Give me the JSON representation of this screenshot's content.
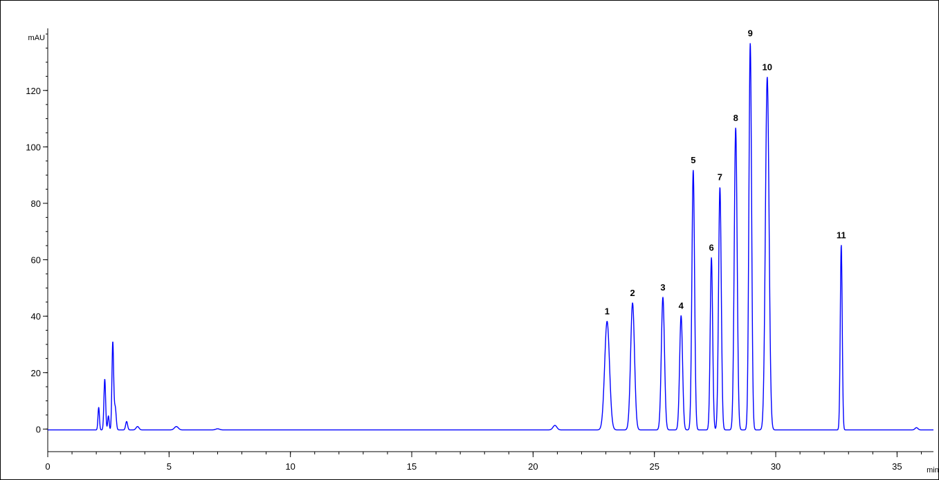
{
  "chart_data": {
    "type": "line",
    "title": "",
    "xlabel": "min",
    "ylabel": "mAU",
    "xlim": [
      0,
      36.5
    ],
    "ylim": [
      -8,
      142
    ],
    "x_ticks": [
      0,
      5,
      10,
      15,
      20,
      25,
      30,
      35
    ],
    "x_tick_labels": [
      "0",
      "5",
      "10",
      "15",
      "20",
      "25",
      "30",
      "35"
    ],
    "x_minor_step": 1,
    "y_ticks": [
      0,
      20,
      40,
      60,
      80,
      100,
      120
    ],
    "y_tick_labels": [
      "0",
      "20",
      "40",
      "60",
      "80",
      "100",
      "120"
    ],
    "y_minor_step": 5,
    "grid": false,
    "legend": "none",
    "baseline_mAU": -0.3,
    "series": [
      {
        "color": "#0000ff",
        "peaks": [
          {
            "rt": 2.1,
            "height": 8,
            "width": 0.03
          },
          {
            "rt": 2.35,
            "height": 18,
            "width": 0.035
          },
          {
            "rt": 2.5,
            "height": 5,
            "width": 0.03
          },
          {
            "rt": 2.68,
            "height": 31,
            "width": 0.035
          },
          {
            "rt": 2.78,
            "height": 8,
            "width": 0.04
          },
          {
            "rt": 3.25,
            "height": 3,
            "width": 0.04
          },
          {
            "rt": 3.7,
            "height": 1.2,
            "width": 0.06
          },
          {
            "rt": 5.3,
            "height": 1.2,
            "width": 0.08
          },
          {
            "rt": 7.0,
            "height": 0.4,
            "width": 0.08
          },
          {
            "rt": 20.9,
            "height": 1.6,
            "width": 0.08
          },
          {
            "label": "1",
            "rt": 23.05,
            "height": 38.5,
            "width": 0.1
          },
          {
            "label": "2",
            "rt": 24.1,
            "height": 45,
            "width": 0.08
          },
          {
            "label": "3",
            "rt": 25.35,
            "height": 47,
            "width": 0.065
          },
          {
            "label": "4",
            "rt": 26.1,
            "height": 40.5,
            "width": 0.06
          },
          {
            "label": "5",
            "rt": 26.6,
            "height": 92,
            "width": 0.055
          },
          {
            "label": "6",
            "rt": 27.35,
            "height": 61,
            "width": 0.05
          },
          {
            "label": "7",
            "rt": 27.7,
            "height": 86,
            "width": 0.055
          },
          {
            "label": "8",
            "rt": 28.35,
            "height": 107,
            "width": 0.06
          },
          {
            "label": "9",
            "rt": 28.95,
            "height": 137,
            "width": 0.055
          },
          {
            "label": "10",
            "rt": 29.65,
            "height": 125,
            "width": 0.075
          },
          {
            "label": "11",
            "rt": 32.7,
            "height": 65.5,
            "width": 0.04
          },
          {
            "rt": 35.8,
            "height": 0.8,
            "width": 0.06
          }
        ]
      }
    ]
  }
}
